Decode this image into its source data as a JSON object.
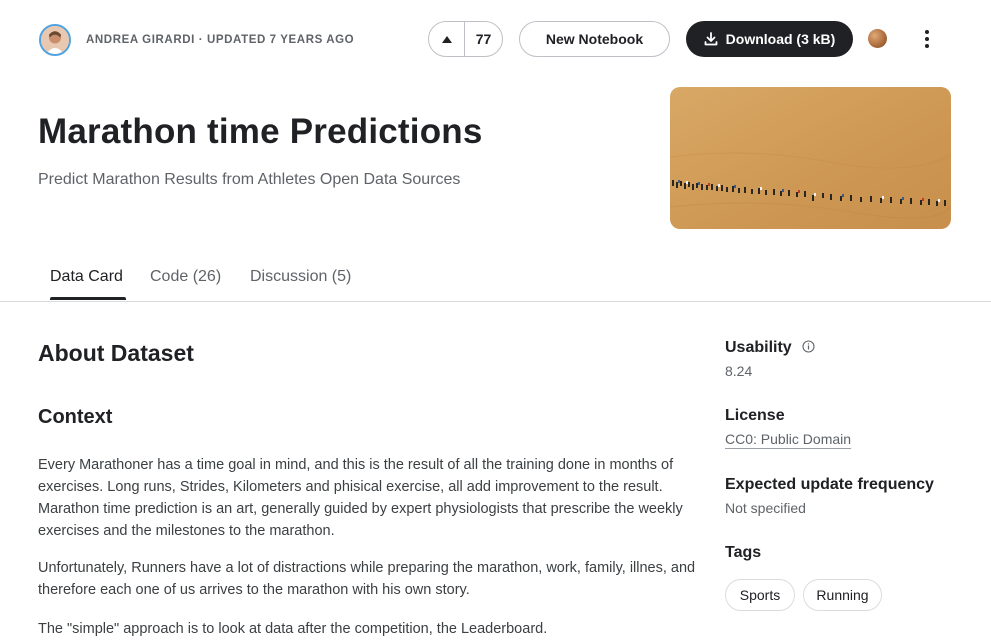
{
  "header": {
    "author_line": "ANDREA GIRARDI · UPDATED 7 YEARS AGO",
    "vote_count": "77",
    "new_notebook_label": "New Notebook",
    "download_label": "Download (3 kB)"
  },
  "dataset": {
    "title": "Marathon time Predictions",
    "subtitle": "Predict Marathon Results from Athletes Open Data Sources"
  },
  "tabs": [
    {
      "label": "Data Card",
      "active": true
    },
    {
      "label": "Code (26)",
      "active": false
    },
    {
      "label": "Discussion (5)",
      "active": false
    }
  ],
  "about": {
    "heading": "About Dataset",
    "context_heading": "Context",
    "paragraphs": [
      "Every Marathoner has a time goal in mind, and this is the result of all the training done in months of exercises. Long runs, Strides, Kilometers and phisical exercise, all add improvement to the result. Marathon time prediction is an art, generally guided by expert physiologists that prescribe the weekly exercises and the milestones to the marathon.",
      "Unfortunately, Runners have a lot of distractions while preparing the marathon, work, family, illnes, and therefore each one of us arrives to the marathon with his own story.",
      "The \"simple\" approach is to look at data after the competition, the Leaderboard."
    ]
  },
  "sidebar": {
    "usability_label": "Usability",
    "usability_value": "8.24",
    "license_label": "License",
    "license_value": "CC0: Public Domain",
    "frequency_label": "Expected update frequency",
    "frequency_value": "Not specified",
    "tags_label": "Tags",
    "tags": [
      "Sports",
      "Running"
    ]
  },
  "colors": {
    "primary_dark": "#202124",
    "secondary_text": "#5f6368",
    "border": "#dadce0",
    "hero_sand": "#d29d5a"
  },
  "icons": [
    "avatar",
    "upvote-icon",
    "download-icon",
    "medal-icon",
    "more-vert-icon",
    "info-icon"
  ]
}
